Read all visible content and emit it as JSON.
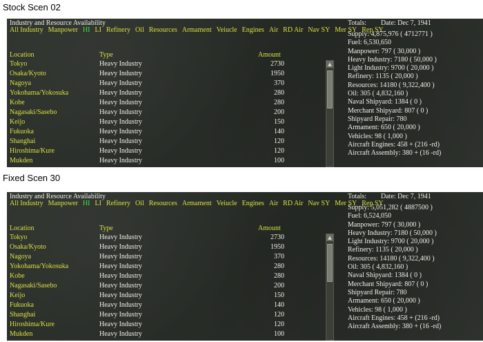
{
  "panels": [
    {
      "caption": "Stock Scen 02",
      "title": "Industry and Resource Availability",
      "filters": [
        {
          "label": "All Industry",
          "active": false
        },
        {
          "label": "Manpower",
          "active": false
        },
        {
          "label": "HI",
          "active": true
        },
        {
          "label": "LI",
          "active": false
        },
        {
          "label": "Refinery",
          "active": false
        },
        {
          "label": "Oil",
          "active": false
        },
        {
          "label": "Resources",
          "active": false
        },
        {
          "label": "Armament",
          "active": false
        },
        {
          "label": "Veiucle",
          "active": false
        },
        {
          "label": "Engines",
          "active": false
        },
        {
          "label": "Air",
          "active": false
        },
        {
          "label": "RD Air",
          "active": false
        },
        {
          "label": "Nav SY",
          "active": false
        },
        {
          "label": "Mer SY",
          "active": false
        },
        {
          "label": "Rep SY",
          "active": false
        }
      ],
      "columns": {
        "location": "Location",
        "type": "Type",
        "amount": "Amount"
      },
      "rows": [
        {
          "location": "Tokyo",
          "type": "Heavy Industry",
          "amount": "2730"
        },
        {
          "location": "Osaka/Kyoto",
          "type": "Heavy Industry",
          "amount": "1950"
        },
        {
          "location": "Nagoya",
          "type": "Heavy Industry",
          "amount": "370"
        },
        {
          "location": "Yokohama/Yokosuka",
          "type": "Heavy Industry",
          "amount": "280"
        },
        {
          "location": "Kobe",
          "type": "Heavy Industry",
          "amount": "280"
        },
        {
          "location": "Nagasaki/Sasebo",
          "type": "Heavy Industry",
          "amount": "200"
        },
        {
          "location": "Keijo",
          "type": "Heavy Industry",
          "amount": "150"
        },
        {
          "location": "Fukuoka",
          "type": "Heavy Industry",
          "amount": "140"
        },
        {
          "location": "Shanghai",
          "type": "Heavy Industry",
          "amount": "120"
        },
        {
          "location": "Hiroshima/Kure",
          "type": "Heavy Industry",
          "amount": "120"
        },
        {
          "location": "Mukden",
          "type": "Heavy Industry",
          "amount": "100"
        }
      ],
      "totals_label": "Totals:",
      "date": "Date: Dec 7, 1941",
      "totals": [
        "Supply: 4,875,976 ( 4712771 )",
        "Fuel: 6,530,650",
        "Manpower: 797 ( 30,000 )",
        "Heavy Industry: 7180 ( 50,000 )",
        "Light Industry: 9700 ( 20,000 )",
        "Refinery: 1135 ( 20,000 )",
        "Resources: 14180 ( 9,322,400 )",
        "Oil: 305 ( 4,832,160 )",
        "Naval Shipyard: 1384 ( 0 )",
        "Merchant Shipyard: 807 ( 0 )",
        "Shipyard Repair: 780",
        "Armament: 650 ( 20,000 )",
        "Vehicles: 98 ( 1,000 )",
        "Aircraft Engines: 458 + (216 -rd)",
        "Aircraft Assembly: 380 + (16 -rd)"
      ]
    },
    {
      "caption": "Fixed Scen 30",
      "title": "Industry and Resource Availability",
      "filters": [
        {
          "label": "All Industry",
          "active": false
        },
        {
          "label": "Manpower",
          "active": false
        },
        {
          "label": "HI",
          "active": true
        },
        {
          "label": "LI",
          "active": false
        },
        {
          "label": "Refinery",
          "active": false
        },
        {
          "label": "Oil",
          "active": false
        },
        {
          "label": "Resources",
          "active": false
        },
        {
          "label": "Armament",
          "active": false
        },
        {
          "label": "Veiucle",
          "active": false
        },
        {
          "label": "Engines",
          "active": false
        },
        {
          "label": "Air",
          "active": false
        },
        {
          "label": "RD Air",
          "active": false
        },
        {
          "label": "Nav SY",
          "active": false
        },
        {
          "label": "Mer SY",
          "active": false
        },
        {
          "label": "Rep SY",
          "active": false
        }
      ],
      "columns": {
        "location": "Location",
        "type": "Type",
        "amount": "Amount"
      },
      "rows": [
        {
          "location": "Tokyo",
          "type": "Heavy Industry",
          "amount": "2730"
        },
        {
          "location": "Osaka/Kyoto",
          "type": "Heavy Industry",
          "amount": "1950"
        },
        {
          "location": "Nagoya",
          "type": "Heavy Industry",
          "amount": "370"
        },
        {
          "location": "Yokohama/Yokosuka",
          "type": "Heavy Industry",
          "amount": "280"
        },
        {
          "location": "Kobe",
          "type": "Heavy Industry",
          "amount": "280"
        },
        {
          "location": "Nagasaki/Sasebo",
          "type": "Heavy Industry",
          "amount": "200"
        },
        {
          "location": "Keijo",
          "type": "Heavy Industry",
          "amount": "150"
        },
        {
          "location": "Fukuoka",
          "type": "Heavy Industry",
          "amount": "140"
        },
        {
          "location": "Shanghai",
          "type": "Heavy Industry",
          "amount": "120"
        },
        {
          "location": "Hiroshima/Kure",
          "type": "Heavy Industry",
          "amount": "120"
        },
        {
          "location": "Mukden",
          "type": "Heavy Industry",
          "amount": "100"
        }
      ],
      "totals_label": "Totals:",
      "date": "Date: Dec 7, 1941",
      "totals": [
        "Supply: 5,051,282 ( 4887500 )",
        "Fuel: 6,524,050",
        "Manpower: 797 ( 30,000 )",
        "Heavy Industry: 7180 ( 50,000 )",
        "Light Industry: 9700 ( 20,000 )",
        "Refinery: 1135 ( 20,000 )",
        "Resources: 14180 ( 9,322,400 )",
        "Oil: 305 ( 4,832,160 )",
        "Naval Shipyard: 1384 ( 0 )",
        "Merchant Shipyard: 807 ( 0 )",
        "Shipyard Repair: 780",
        "Armament: 650 ( 20,000 )",
        "Vehicles: 98 ( 1,000 )",
        "Aircraft Engines: 458 + (216 -rd)",
        "Aircraft Assembly: 380 + (16 -rd)"
      ]
    }
  ]
}
